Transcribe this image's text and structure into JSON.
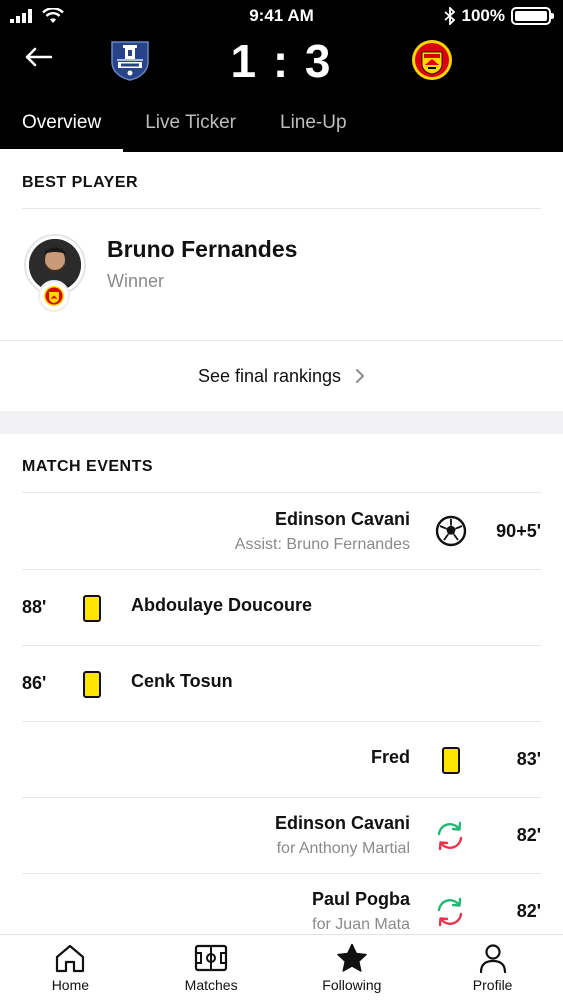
{
  "status_bar": {
    "time": "9:41 AM",
    "battery": "100%"
  },
  "header": {
    "score": "1 : 3",
    "home_team_icon": "everton-crest",
    "away_team_icon": "manchester-united-crest",
    "tabs": [
      {
        "label": "Overview",
        "active": true
      },
      {
        "label": "Live Ticker",
        "active": false
      },
      {
        "label": "Line-Up",
        "active": false
      }
    ]
  },
  "best_player": {
    "section_title": "BEST PLAYER",
    "name": "Bruno Fernandes",
    "role": "Winner",
    "rankings_link": "See final rankings"
  },
  "match_events": {
    "section_title": "MATCH EVENTS",
    "events": [
      {
        "side": "away",
        "type": "goal",
        "minute": "90+5'",
        "player": "Edinson Cavani",
        "detail": "Assist: Bruno Fernandes"
      },
      {
        "side": "home",
        "type": "yellow-card",
        "minute": "88'",
        "player": "Abdoulaye Doucoure",
        "detail": ""
      },
      {
        "side": "home",
        "type": "yellow-card",
        "minute": "86'",
        "player": "Cenk Tosun",
        "detail": ""
      },
      {
        "side": "away",
        "type": "yellow-card",
        "minute": "83'",
        "player": "Fred",
        "detail": ""
      },
      {
        "side": "away",
        "type": "substitution",
        "minute": "82'",
        "player": "Edinson Cavani",
        "detail": "for Anthony Martial"
      },
      {
        "side": "away",
        "type": "substitution",
        "minute": "82'",
        "player": "Paul Pogba",
        "detail": "for Juan Mata"
      }
    ]
  },
  "bottom_nav": [
    {
      "label": "Home",
      "icon": "home-icon"
    },
    {
      "label": "Matches",
      "icon": "pitch-icon"
    },
    {
      "label": "Following",
      "icon": "star-icon"
    },
    {
      "label": "Profile",
      "icon": "person-icon"
    }
  ],
  "colors": {
    "header_bg": "#000000",
    "yellow_card": "#ffe600",
    "sub_in": "#21b873",
    "sub_out": "#e8344a",
    "everton_blue": "#274488",
    "united_red": "#da020e"
  }
}
